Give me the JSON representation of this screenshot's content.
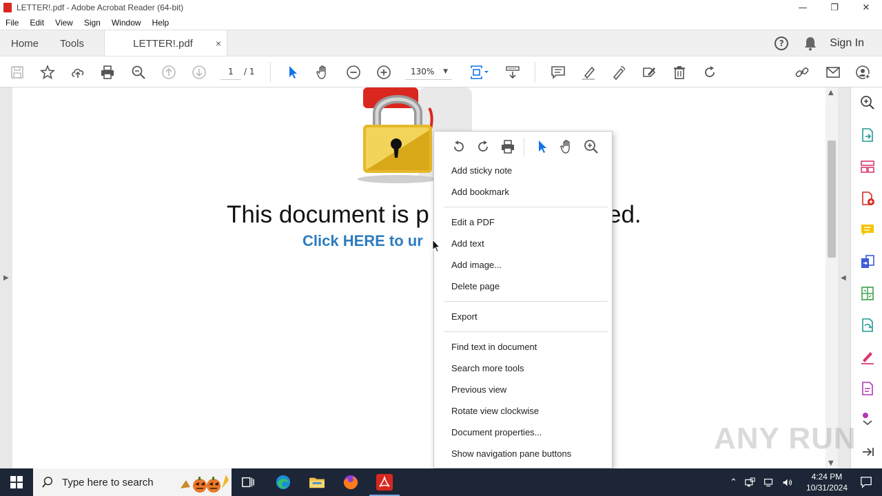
{
  "window": {
    "title": "LETTER!.pdf - Adobe Acrobat Reader (64-bit)",
    "controls": {
      "minimize": "—",
      "restore": "❐",
      "close": "✕"
    }
  },
  "menu": [
    "File",
    "Edit",
    "View",
    "Sign",
    "Window",
    "Help"
  ],
  "tabs": {
    "home": "Home",
    "tools": "Tools",
    "document": "LETTER!.pdf",
    "close_glyph": "×"
  },
  "header": {
    "help_glyph": "?",
    "sign_in": "Sign In"
  },
  "toolbar": {
    "page_current": "1",
    "page_total": "/ 1",
    "zoom": "130%",
    "zoom_caret": "▼"
  },
  "document": {
    "heading_start": "This document is p",
    "heading_end": "ed.",
    "link_text": "Click HERE to ur"
  },
  "context_menu": {
    "groups": [
      [
        "Add sticky note",
        "Add bookmark"
      ],
      [
        "Edit a PDF",
        "Add text",
        "Add image...",
        "Delete page"
      ],
      [
        "Export"
      ],
      [
        "Find text in document",
        "Search more tools",
        "Previous view",
        "Rotate view clockwise",
        "Document properties...",
        "Show navigation pane buttons"
      ]
    ]
  },
  "watermark": "ANY RUN",
  "taskbar": {
    "search_placeholder": "Type here to search",
    "time": "4:24 PM",
    "date": "10/31/2024"
  },
  "colors": {
    "acrobat_red": "#d9271f",
    "select_blue": "#1473e6",
    "link_blue": "#2c7bbf",
    "taskbar": "#1c2636"
  }
}
